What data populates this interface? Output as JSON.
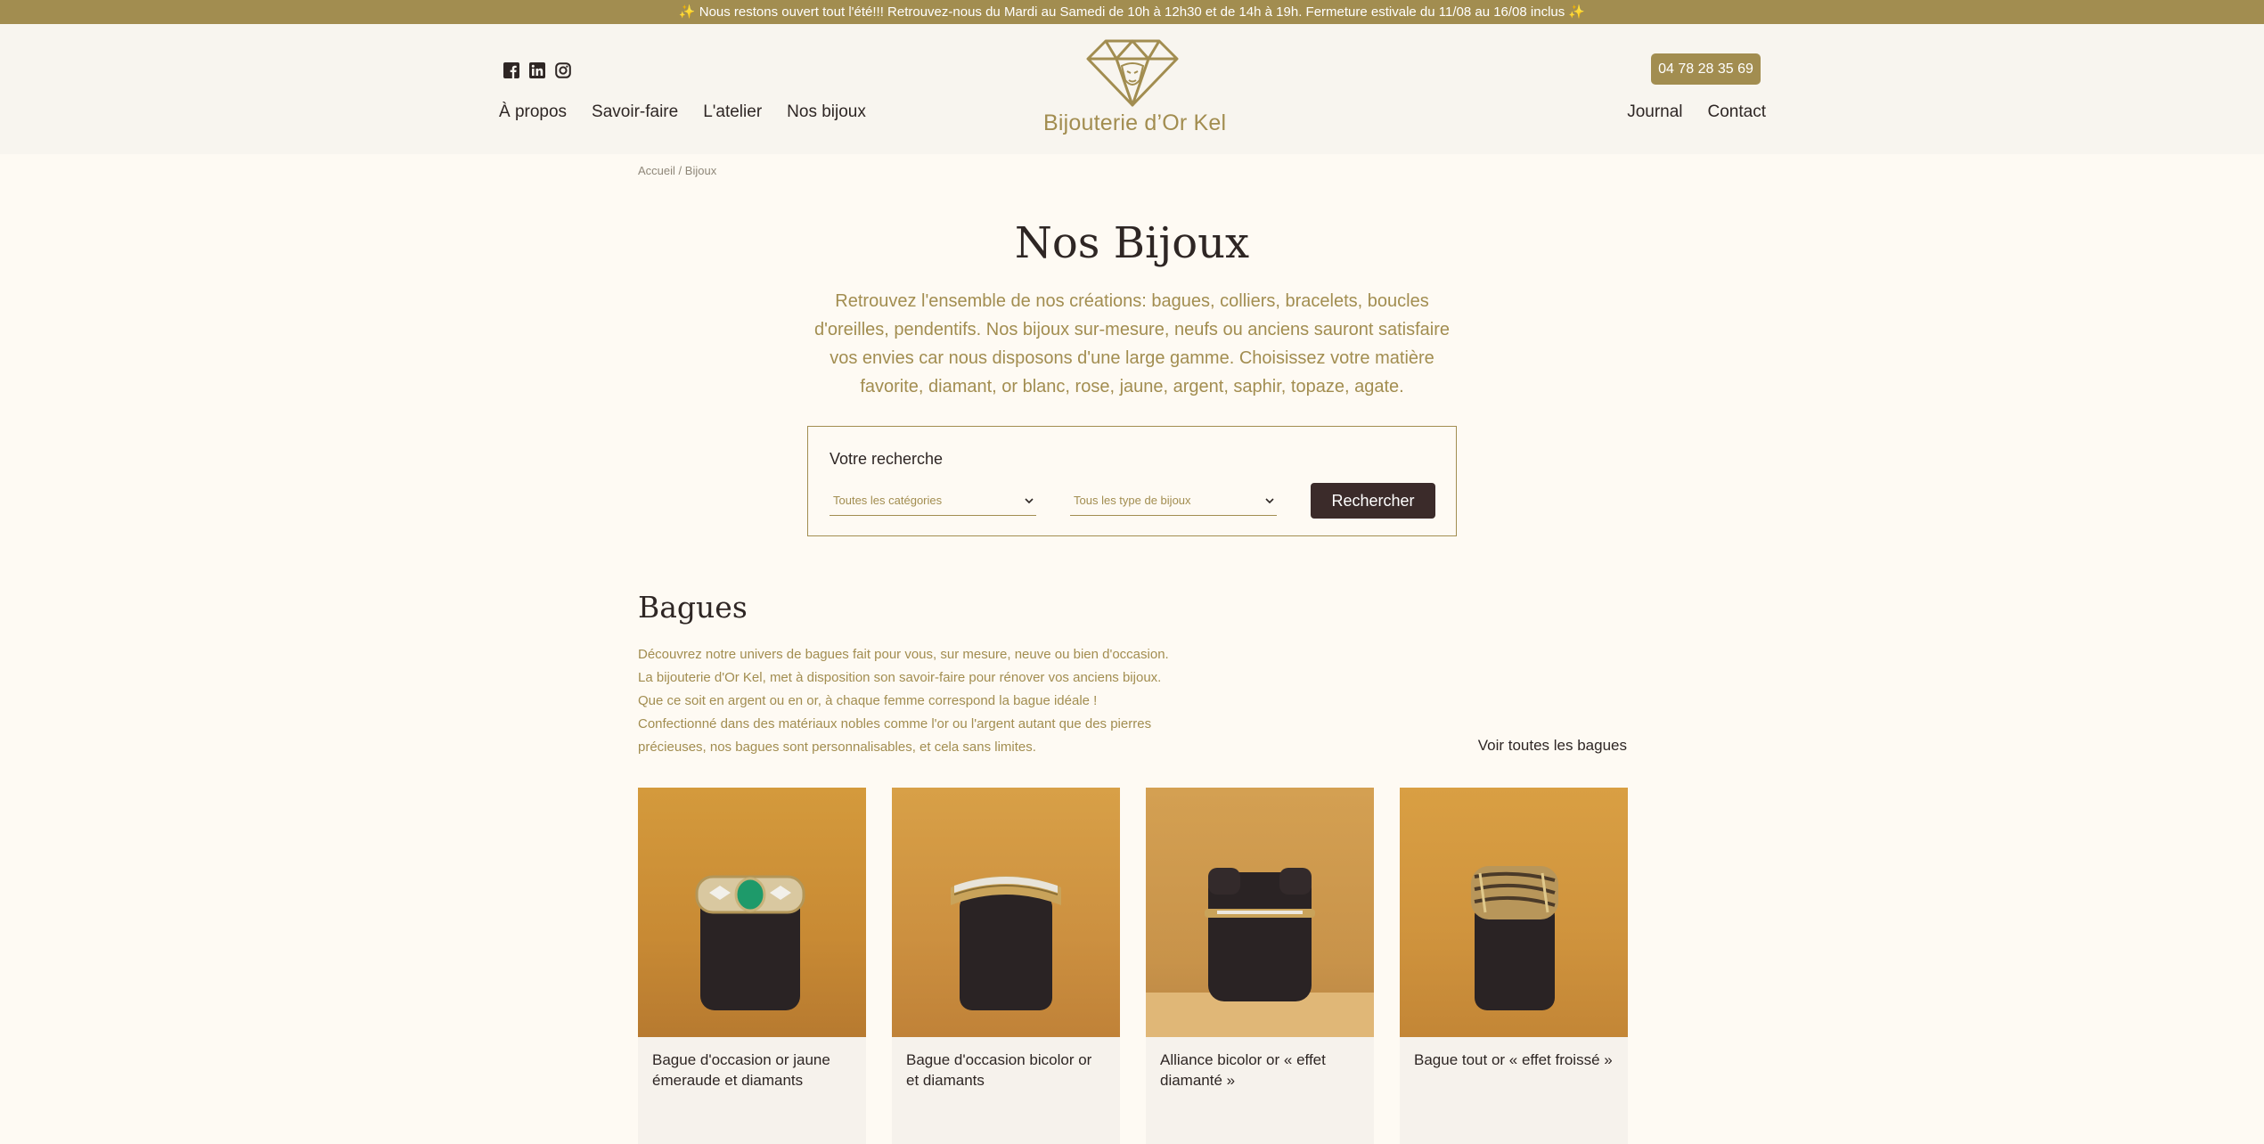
{
  "announcement": "✨ Nous restons ouvert tout l'été!!! Retrouvez-nous du Mardi au Samedi de 10h à 12h30 et de 14h à 19h. Fermeture estivale du 11/08 au 16/08 inclus ✨",
  "header": {
    "social": [
      {
        "name": "facebook-icon"
      },
      {
        "name": "linkedin-icon"
      },
      {
        "name": "instagram-icon"
      }
    ],
    "nav_left": [
      "À propos",
      "Savoir-faire",
      "L'atelier",
      "Nos bijoux"
    ],
    "nav_right": [
      "Journal",
      "Contact"
    ],
    "logo_text": "Bijouterie d’Or Kel",
    "phone": "04 78 28 35 69"
  },
  "breadcrumb": {
    "home": "Accueil",
    "separator": "/",
    "current": "Bijoux"
  },
  "page_title": "Nos Bijoux",
  "intro": "Retrouvez l'ensemble de nos créations: bagues, colliers, bracelets, boucles d'oreilles, pendentifs. Nos bijoux sur-mesure, neufs ou anciens sauront satisfaire vos envies car nous disposons d'une large gamme. Choisissez votre matière favorite, diamant, or blanc, rose, jaune, argent, saphir, topaze, agate.",
  "search": {
    "title": "Votre recherche",
    "category_select": "Toutes les catégories",
    "type_select": "Tous les type de bijoux",
    "button": "Rechercher"
  },
  "section": {
    "title": "Bagues",
    "description_lines": [
      "Découvrez notre univers de bagues fait pour vous, sur mesure, neuve ou bien d'occasion.",
      "La bijouterie d'Or Kel, met à disposition son savoir-faire pour rénover vos anciens bijoux.",
      "Que ce soit en argent ou en or, à chaque femme correspond la bague idéale !",
      "Confectionné dans des matériaux nobles comme l'or ou l'argent autant que des pierres",
      "précieuses, nos bagues sont personnalisables, et cela sans limites."
    ],
    "see_all": "Voir toutes les bagues",
    "products": [
      {
        "title": "Bague d'occasion or jaune émeraude et diamants"
      },
      {
        "title": "Bague d'occasion bicolor or et diamants"
      },
      {
        "title": "Alliance bicolor or « effet diamanté »"
      },
      {
        "title": "Bague tout or « effet froissé »"
      }
    ]
  },
  "colors": {
    "gold": "#a28d50",
    "dark": "#3b2b2a",
    "background": "#fefaf3",
    "header_bg": "#f8f5ef"
  }
}
